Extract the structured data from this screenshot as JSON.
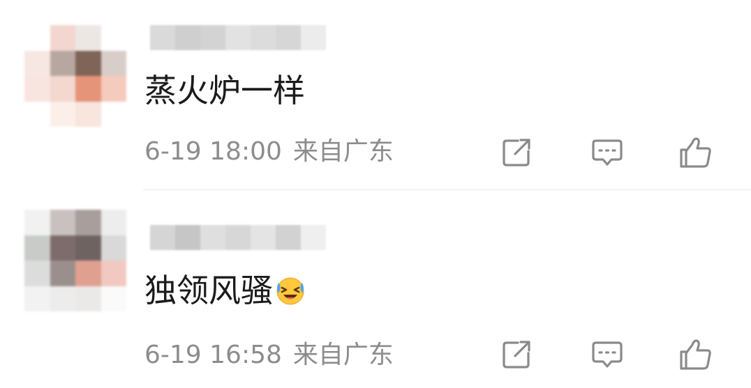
{
  "comments": [
    {
      "text": "蒸火炉一样",
      "emoji": null,
      "time": "6-19 18:00",
      "location": "来自广东",
      "avatar_pixels": [
        "#ffffff",
        "#f3d6cf",
        "#ede7e4",
        "#ffffff",
        "#f6e7e2",
        "#b8a7a1",
        "#7e6557",
        "#d8cdc9",
        "#f9e5df",
        "#f2d8ce",
        "#e59479",
        "#f5cbbd",
        "#ffffff",
        "#fcefea",
        "#f7e5de",
        "#ffffff"
      ],
      "username_pixels": [
        "#dadada",
        "#cfcfcf",
        "#d3d3d3",
        "#e2e2e2",
        "#dcdcdc",
        "#d6d6d6",
        "#ececec"
      ]
    },
    {
      "text": "独领风骚",
      "emoji": "grinning-squinting-tears-emoji",
      "time": "6-19 16:58",
      "location": "来自广东",
      "avatar_pixels": [
        "#f1f1f1",
        "#c9c1bf",
        "#a89f9c",
        "#ededed",
        "#c8cbc8",
        "#7d6c6a",
        "#6f6361",
        "#d9d9d9",
        "#dcdcdc",
        "#9b8f8d",
        "#e0a090",
        "#f1c9c1",
        "#f2f2f2",
        "#ececec",
        "#ebe9e8",
        "#fafafa"
      ],
      "username_pixels": [
        "#d5d5d5",
        "#c6c6c6",
        "#dfdfdf",
        "#d7d7d7",
        "#e4e4e4",
        "#d2d2d2",
        "#efefef"
      ]
    }
  ],
  "actions": {
    "share_icon": "share-icon",
    "reply_icon": "reply-icon",
    "like_icon": "thumbs-up-icon"
  },
  "colors": {
    "text": "#1b1b1b",
    "meta": "#8c8c8c",
    "icon": "#8a8a8a",
    "divider": "#e9e9e9",
    "emoji_face": "#ffc83d",
    "emoji_tear": "#4fa8ec"
  }
}
